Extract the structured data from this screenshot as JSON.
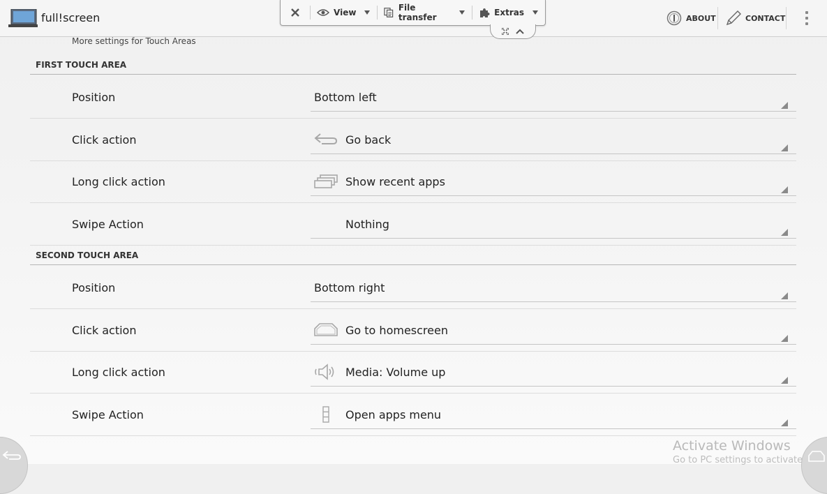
{
  "app": {
    "title": "full!screen",
    "logo_icon": "monitor-icon"
  },
  "actions": {
    "about": "ABOUT",
    "contact": "CONTACT"
  },
  "toolbar": {
    "view": "View",
    "file_transfer": "File transfer",
    "extras": "Extras"
  },
  "subtitle": "More settings for Touch Areas",
  "sections": [
    {
      "header": "FIRST TOUCH AREA",
      "rows": [
        {
          "label": "Position",
          "value": "Bottom left",
          "icon": ""
        },
        {
          "label": "Click action",
          "value": "Go back",
          "icon": "back-arrow-icon"
        },
        {
          "label": "Long click action",
          "value": "Show recent apps",
          "icon": "recent-apps-icon"
        },
        {
          "label": "Swipe Action",
          "value": "Nothing",
          "icon": "none"
        }
      ]
    },
    {
      "header": "SECOND TOUCH AREA",
      "rows": [
        {
          "label": "Position",
          "value": "Bottom right",
          "icon": ""
        },
        {
          "label": "Click action",
          "value": "Go to homescreen",
          "icon": "home-icon"
        },
        {
          "label": "Long click action",
          "value": "Media: Volume up",
          "icon": "volume-up-icon"
        },
        {
          "label": "Swipe Action",
          "value": "Open apps menu",
          "icon": "apps-menu-icon"
        }
      ]
    }
  ],
  "watermark": {
    "line1": "Activate Windows",
    "line2": "Go to PC settings to activate"
  }
}
